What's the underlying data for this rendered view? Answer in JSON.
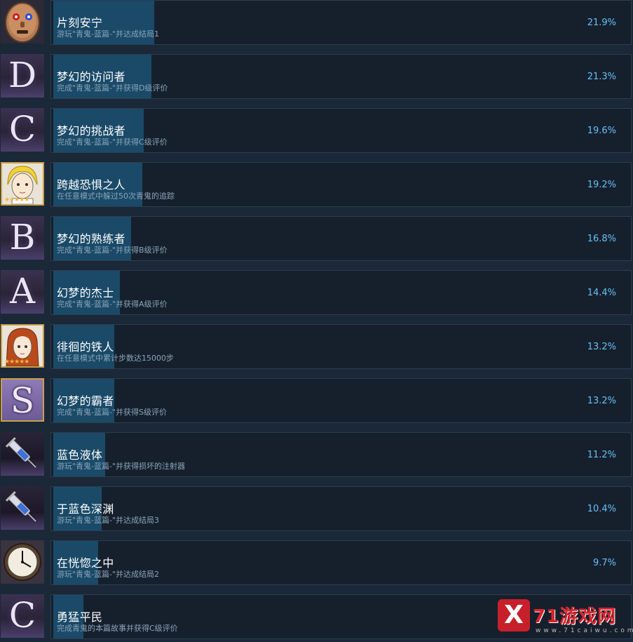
{
  "achievements": [
    {
      "title": "片刻安宁",
      "desc": "游玩\"青鬼-蓝篇-\"并达成结局1",
      "percent": "21.9%",
      "progress": 0.219,
      "icon": "mask-face-icon"
    },
    {
      "title": "梦幻的访问者",
      "desc": "完成\"青鬼-蓝篇-\"并获得D级评价",
      "percent": "21.3%",
      "progress": 0.213,
      "icon": "letter-d-icon",
      "letter": "D"
    },
    {
      "title": "梦幻的挑战者",
      "desc": "完成\"青鬼-蓝篇-\"并获得C级评价",
      "percent": "19.6%",
      "progress": 0.196,
      "icon": "letter-c-icon",
      "letter": "C"
    },
    {
      "title": "跨越恐惧之人",
      "desc": "在任意模式中躲过50次青鬼的追踪",
      "percent": "19.2%",
      "progress": 0.192,
      "icon": "blonde-portrait-icon"
    },
    {
      "title": "梦幻的熟练者",
      "desc": "完成\"青鬼-蓝篇-\"并获得B级评价",
      "percent": "16.8%",
      "progress": 0.168,
      "icon": "letter-b-icon",
      "letter": "B"
    },
    {
      "title": "幻梦的杰士",
      "desc": "完成\"青鬼-蓝篇-\"并获得A级评价",
      "percent": "14.4%",
      "progress": 0.144,
      "icon": "letter-a-icon",
      "letter": "A"
    },
    {
      "title": "徘徊的铁人",
      "desc": "在任意模式中累计步数达15000步",
      "percent": "13.2%",
      "progress": 0.132,
      "icon": "redhair-portrait-icon"
    },
    {
      "title": "幻梦的霸者",
      "desc": "完成\"青鬼-蓝篇-\"并获得S级评价",
      "percent": "13.2%",
      "progress": 0.132,
      "icon": "letter-s-icon",
      "letter": "S"
    },
    {
      "title": "蓝色液体",
      "desc": "游玩\"青鬼-蓝篇-\"并获得损坏的注射器",
      "percent": "11.2%",
      "progress": 0.112,
      "icon": "syringe-icon"
    },
    {
      "title": "于蓝色深渊",
      "desc": "游玩\"青鬼-蓝篇-\"并达成结局3",
      "percent": "10.4%",
      "progress": 0.104,
      "icon": "syringe-icon"
    },
    {
      "title": "在恍惚之中",
      "desc": "游玩\"青鬼-蓝篇-\"并达成结局2",
      "percent": "9.7%",
      "progress": 0.097,
      "icon": "clock-icon"
    },
    {
      "title": "勇猛平民",
      "desc": "完成青鬼的本篇故事并获得C级评价",
      "percent": "",
      "progress": 0.065,
      "icon": "letter-c-icon",
      "letter": "C"
    }
  ],
  "watermark": {
    "text": "71游戏网",
    "mark": "X",
    "url": "www.71caiwu.com"
  },
  "colors": {
    "background": "#1b2838",
    "progress": "#1a4a68",
    "percent": "#66c0f4",
    "gold_border": "#c9a04a"
  }
}
